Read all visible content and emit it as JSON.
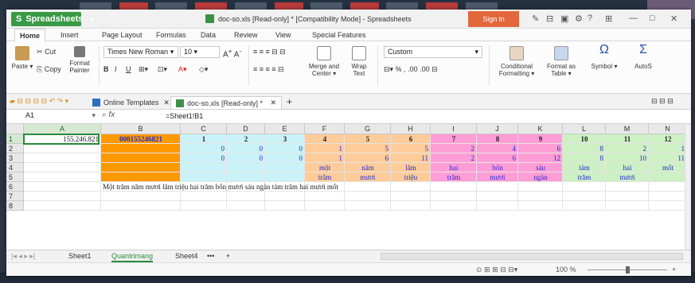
{
  "app": {
    "name": "Spreadsheets",
    "title": "doc-so.xls [Read-only] * [Compatibility Mode] - Spreadsheets",
    "sign_in": "Sign in"
  },
  "menu": [
    "Home",
    "Insert",
    "Page Layout",
    "Formulas",
    "Data",
    "Review",
    "View",
    "Special Features"
  ],
  "ribbon": {
    "paste": "Paste",
    "cut": "Cut",
    "copy": "Copy",
    "format_painter": [
      "Format",
      "Painter"
    ],
    "font_name": "Times New Roman",
    "font_size": "10",
    "merge": [
      "Merge and",
      "Center"
    ],
    "wrap": [
      "Wrap",
      "Text"
    ],
    "number_format": "Custom",
    "conditional": [
      "Conditional",
      "Formatting"
    ],
    "format_table": [
      "Format as",
      "Table"
    ],
    "symbol": "Symbol",
    "autosum": "AutoS"
  },
  "doc_tabs": [
    "Online Templates",
    "doc-so.xls [Read-only] *"
  ],
  "formula_bar": {
    "name_box": "A1",
    "fx": "fx",
    "formula": "=Sheet1!B1"
  },
  "columns": [
    "A",
    "B",
    "C",
    "D",
    "E",
    "F",
    "G",
    "H",
    "I",
    "J",
    "K",
    "L",
    "M",
    "N"
  ],
  "rows": [
    "1",
    "2",
    "3",
    "4",
    "5",
    "6",
    "7",
    "8"
  ],
  "cells": {
    "A1": "155.246.821",
    "B1": "000155246821",
    "C1": "1",
    "D1": "2",
    "E1": "3",
    "F1": "4",
    "G1": "5",
    "H1": "6",
    "I1": "7",
    "J1": "8",
    "K1": "9",
    "L1": "10",
    "M1": "11",
    "N1": "12",
    "C2": "0",
    "D2": "0",
    "E2": "0",
    "F2": "1",
    "G2": "5",
    "H2": "5",
    "I2": "2",
    "J2": "4",
    "K2": "6",
    "L2": "8",
    "M2": "2",
    "N2": "1",
    "C3": "0",
    "D3": "0",
    "E3": "0",
    "F3": "1",
    "G3": "6",
    "H3": "11",
    "I3": "2",
    "J3": "6",
    "K3": "12",
    "L3": "8",
    "M3": "10",
    "N3": "11",
    "F4": "một",
    "G4": "năm",
    "H4": "lăm",
    "I4": "hai",
    "J4": "bốn",
    "K4": "sáu",
    "L4": "tám",
    "M4": "hai",
    "N4": "mốt",
    "F5": "trăm",
    "G5": "mươi",
    "H5": "triệu",
    "I5": "trăm",
    "J5": "mươi",
    "K5": "ngàn",
    "L5": "trăm",
    "M5": "mươi",
    "B6": "Một trăm năm mươi lăm triệu hai trăm bốn mươi sáu ngàn tám trăm hai mươi mốt"
  },
  "colors": {
    "orange": "#ff9900",
    "cyan": "#c9f3f8",
    "peach": "#ffcc99",
    "pink": "#ff9dd6",
    "green": "#cdf0c4",
    "accent": "#3a9a44",
    "blue_text": "#1f2ad6"
  },
  "sheets": [
    "Sheet1",
    "Quantrimang",
    "Sheet4"
  ],
  "status": {
    "zoom": "100 %"
  }
}
